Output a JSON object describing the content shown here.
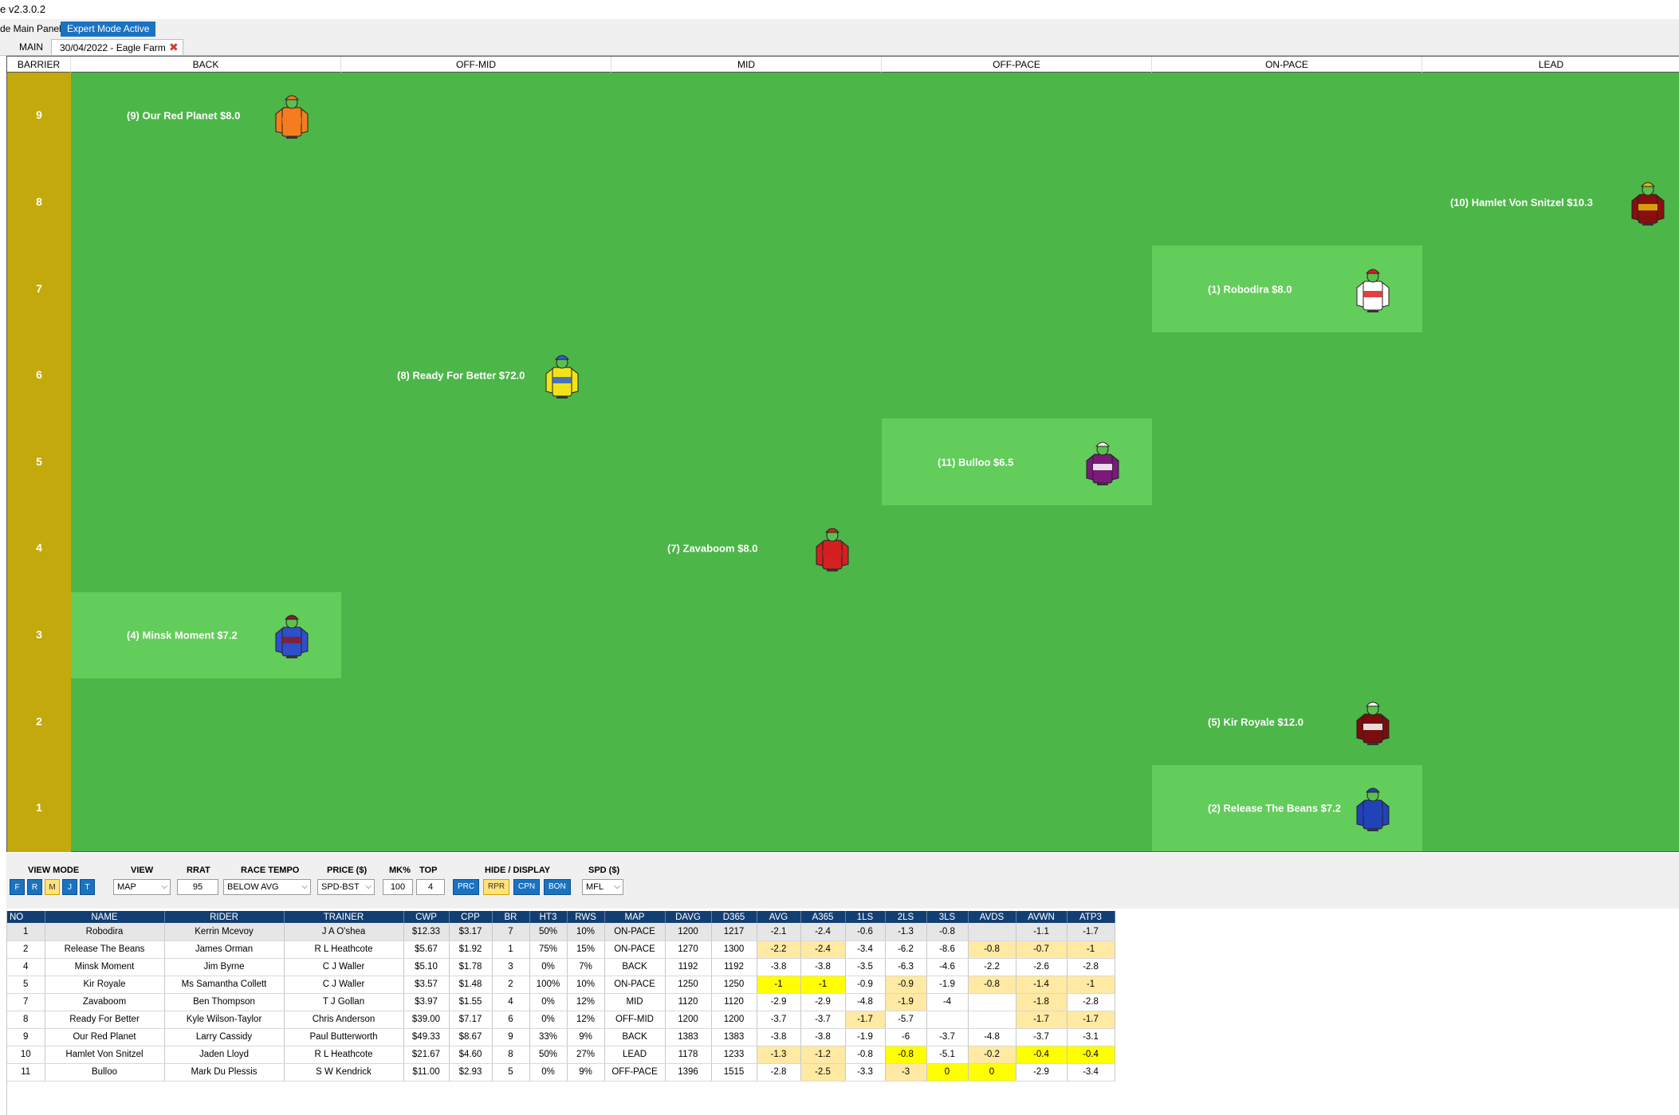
{
  "window": {
    "title": "e v2.3.0.2"
  },
  "menu": {
    "hide_panel": "de Main Panel",
    "expert_mode": "Expert Mode Active"
  },
  "tabs": {
    "main": "MAIN",
    "race": "30/04/2022 - Eagle Farm",
    "close_glyph": "✖"
  },
  "map": {
    "barrier_header": "BARRIER",
    "columns": [
      "BACK",
      "OFF-MID",
      "MID",
      "OFF-PACE",
      "ON-PACE",
      "LEAD"
    ],
    "barriers": [
      "9",
      "8",
      "7",
      "6",
      "5",
      "4",
      "3",
      "2",
      "1"
    ],
    "runners": [
      {
        "label": "(9) Our Red Planet $8.0",
        "barrier": 9,
        "position": 0,
        "silk": "silk-orange-icon",
        "colors": [
          "#f57c1f",
          "#f57c1f"
        ],
        "highlight": false
      },
      {
        "label": "(10) Hamlet Von Snitzel $10.3",
        "barrier": 8,
        "position": 5,
        "silk": "silk-maroon-diamonds-icon",
        "colors": [
          "#8a0e0e",
          "#e6b800"
        ],
        "highlight": false
      },
      {
        "label": "(1) Robodira $8.0",
        "barrier": 7,
        "position": 4,
        "silk": "silk-red-white-quarters-icon",
        "colors": [
          "#ffffff",
          "#d92020"
        ],
        "highlight": true
      },
      {
        "label": "(8) Ready For Better $72.0",
        "barrier": 6,
        "position": 1,
        "silk": "silk-yellow-stars-icon",
        "colors": [
          "#f2e21a",
          "#2a5fd6"
        ],
        "highlight": false
      },
      {
        "label": "(11) Bulloo $6.5",
        "barrier": 5,
        "position": 3,
        "silk": "silk-purple-spots-icon",
        "colors": [
          "#7a1a7a",
          "#ffffff"
        ],
        "highlight": true
      },
      {
        "label": "(7) Zavaboom $8.0",
        "barrier": 4,
        "position": 2,
        "silk": "silk-red-icon",
        "colors": [
          "#d32020",
          "#d32020"
        ],
        "highlight": false
      },
      {
        "label": "(4) Minsk Moment $7.2",
        "barrier": 3,
        "position": 0,
        "silk": "silk-blue-maroon-hoops-icon",
        "colors": [
          "#2f50c9",
          "#8a1a2a"
        ],
        "highlight": true
      },
      {
        "label": "(5) Kir Royale $12.0",
        "barrier": 2,
        "position": 4,
        "silk": "silk-maroon-white-cross-icon",
        "colors": [
          "#7a0e0e",
          "#ffffff"
        ],
        "highlight": false
      },
      {
        "label": "(2) Release The Beans $7.2",
        "barrier": 1,
        "position": 4,
        "silk": "silk-royal-blue-icon",
        "colors": [
          "#2142b8",
          "#2142b8"
        ],
        "highlight": true
      }
    ]
  },
  "controls": {
    "view_mode_label": "VIEW MODE",
    "view_mode_buttons": [
      "F",
      "R",
      "M",
      "J",
      "T"
    ],
    "view_mode_selected": "M",
    "view_label": "VIEW",
    "view_value": "MAP",
    "rrat_label": "RRAT",
    "rrat_value": "95",
    "tempo_label": "RACE TEMPO",
    "tempo_value": "BELOW AVG",
    "price_label": "PRICE ($)",
    "price_value": "SPD-BST",
    "mk_label": "MK%",
    "mk_value": "100",
    "top_label": "TOP",
    "top_value": "4",
    "hide_label": "HIDE / DISPLAY",
    "hide_buttons": [
      "PRC",
      "RPR",
      "CPN",
      "BON"
    ],
    "hide_selected": "RPR",
    "spd_label": "SPD ($)",
    "spd_value": "MFL"
  },
  "table": {
    "headers": [
      "NO",
      "NAME",
      "RIDER",
      "TRAINER",
      "CWP",
      "CPP",
      "BR",
      "HT3",
      "RWS",
      "MAP",
      "DAVG",
      "D365",
      "AVG",
      "A365",
      "1LS",
      "2LS",
      "3LS",
      "AVDS",
      "AVWN",
      "ATP3"
    ],
    "rows": [
      [
        "1",
        "Robodira",
        "Kerrin Mcevoy",
        "J A O'shea",
        "$12.33",
        "$3.17",
        "7",
        "50%",
        "10%",
        "ON-PACE",
        "1200",
        "1217",
        "-2.1",
        "-2.4",
        "-0.6",
        "-1.3",
        "-0.8",
        "",
        "-1.1",
        "-1.7"
      ],
      [
        "2",
        "Release The Beans",
        "James Orman",
        "R L Heathcote",
        "$5.67",
        "$1.92",
        "1",
        "75%",
        "15%",
        "ON-PACE",
        "1270",
        "1300",
        "-2.2",
        "-2.4",
        "-3.4",
        "-6.2",
        "-8.6",
        "-0.8",
        "-0.7",
        "-1"
      ],
      [
        "4",
        "Minsk Moment",
        "Jim Byrne",
        "C J Waller",
        "$5.10",
        "$1.78",
        "3",
        "0%",
        "7%",
        "BACK",
        "1192",
        "1192",
        "-3.8",
        "-3.8",
        "-3.5",
        "-6.3",
        "-4.6",
        "-2.2",
        "-2.6",
        "-2.8"
      ],
      [
        "5",
        "Kir Royale",
        "Ms Samantha Collett",
        "C J Waller",
        "$3.57",
        "$1.48",
        "2",
        "100%",
        "10%",
        "ON-PACE",
        "1250",
        "1250",
        "-1",
        "-1",
        "-0.9",
        "-0.9",
        "-1.9",
        "-0.8",
        "-1.4",
        "-1"
      ],
      [
        "7",
        "Zavaboom",
        "Ben Thompson",
        "T J Gollan",
        "$3.97",
        "$1.55",
        "4",
        "0%",
        "12%",
        "MID",
        "1120",
        "1120",
        "-2.9",
        "-2.9",
        "-4.8",
        "-1.9",
        "-4",
        "",
        "-1.8",
        "-2.8"
      ],
      [
        "8",
        "Ready For Better",
        "Kyle Wilson-Taylor",
        "Chris Anderson",
        "$39.00",
        "$7.17",
        "6",
        "0%",
        "12%",
        "OFF-MID",
        "1200",
        "1200",
        "-3.7",
        "-3.7",
        "-1.7",
        "-5.7",
        "",
        "",
        "-1.7",
        "-1.7"
      ],
      [
        "9",
        "Our Red Planet",
        "Larry Cassidy",
        "Paul Butterworth",
        "$49.33",
        "$8.67",
        "9",
        "33%",
        "9%",
        "BACK",
        "1383",
        "1383",
        "-3.8",
        "-3.8",
        "-1.9",
        "-6",
        "-3.7",
        "-4.8",
        "-3.7",
        "-3.1"
      ],
      [
        "10",
        "Hamlet Von Snitzel",
        "Jaden Lloyd",
        "R L Heathcote",
        "$21.67",
        "$4.60",
        "8",
        "50%",
        "27%",
        "LEAD",
        "1178",
        "1233",
        "-1.3",
        "-1.2",
        "-0.8",
        "-0.8",
        "-5.1",
        "-0.2",
        "-0.4",
        "-0.4"
      ],
      [
        "11",
        "Bulloo",
        "Mark Du Plessis",
        "S W Kendrick",
        "$11.00",
        "$2.93",
        "5",
        "0%",
        "9%",
        "OFF-PACE",
        "1396",
        "1515",
        "-2.8",
        "-2.5",
        "-3.3",
        "-3",
        "0",
        "0",
        "-2.9",
        "-3.4"
      ]
    ],
    "highlights": {
      "light": [
        [
          1,
          12
        ],
        [
          1,
          13
        ],
        [
          1,
          17
        ],
        [
          1,
          18
        ],
        [
          1,
          19
        ],
        [
          3,
          12
        ],
        [
          3,
          13
        ],
        [
          3,
          17
        ],
        [
          3,
          18
        ],
        [
          3,
          19
        ],
        [
          3,
          15
        ],
        [
          4,
          15
        ],
        [
          4,
          18
        ],
        [
          5,
          14
        ],
        [
          5,
          18
        ],
        [
          5,
          19
        ],
        [
          7,
          12
        ],
        [
          7,
          13
        ],
        [
          7,
          17
        ],
        [
          8,
          13
        ],
        [
          8,
          15
        ]
      ],
      "yellow": [
        [
          3,
          12
        ],
        [
          3,
          13
        ],
        [
          7,
          15
        ],
        [
          7,
          18
        ],
        [
          7,
          19
        ],
        [
          8,
          16
        ],
        [
          8,
          17
        ]
      ]
    }
  }
}
